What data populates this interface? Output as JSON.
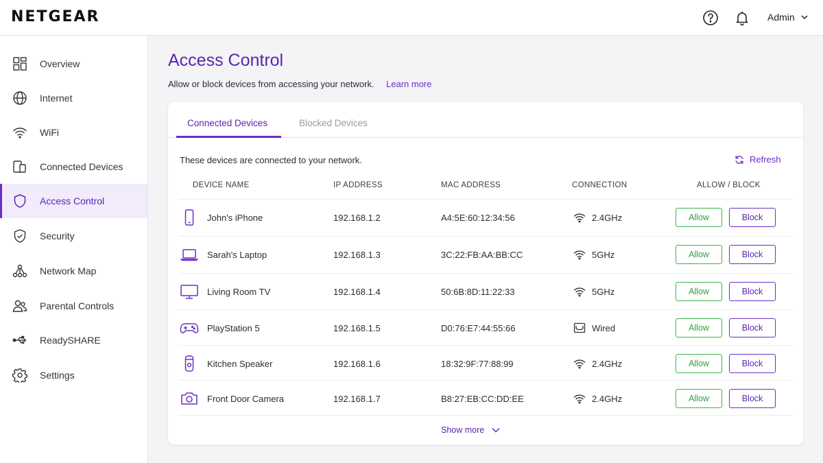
{
  "header": {
    "logo": "NETGEAR",
    "help_icon": "help-circle-icon",
    "notifications_icon": "bell-icon",
    "user_label": "Admin"
  },
  "colors": {
    "accent": "#6a2fc6",
    "allow": "#39b54a",
    "active_bg": "#f1ebfb"
  },
  "sidebar": {
    "items": [
      {
        "label": "Overview",
        "icon": "dashboard-icon",
        "active": false
      },
      {
        "label": "Internet",
        "icon": "globe-icon",
        "active": false
      },
      {
        "label": "WiFi",
        "icon": "wifi-icon",
        "active": false
      },
      {
        "label": "Connected Devices",
        "icon": "devices-icon",
        "active": false
      },
      {
        "label": "Access Control",
        "icon": "shield-icon",
        "active": true
      },
      {
        "label": "Security",
        "icon": "shield-check-icon",
        "active": false
      },
      {
        "label": "Network Map",
        "icon": "network-map-icon",
        "active": false
      },
      {
        "label": "Parental Controls",
        "icon": "users-icon",
        "active": false
      },
      {
        "label": "ReadySHARE",
        "icon": "usb-icon",
        "active": false
      },
      {
        "label": "Settings",
        "icon": "gear-icon",
        "active": false
      }
    ]
  },
  "main": {
    "title": "Access Control",
    "description": "Allow or block devices from accessing your network.",
    "learn_more": "Learn more",
    "tabs": [
      {
        "label": "Connected Devices",
        "active": true
      },
      {
        "label": "Blocked Devices",
        "active": false
      }
    ],
    "card_description": "These devices are connected to your network.",
    "refresh_label": "Refresh",
    "columns": [
      "DEVICE NAME",
      "IP ADDRESS",
      "MAC ADDRESS",
      "CONNECTION",
      "ALLOW / BLOCK"
    ],
    "devices": [
      {
        "name": "John's iPhone",
        "icon": "phone-icon",
        "ip": "192.168.1.2",
        "mac": "A4:5E:60:12:34:56",
        "connection": "2.4GHz",
        "conn_icon": "wifi-icon"
      },
      {
        "name": "Sarah's Laptop",
        "icon": "laptop-icon",
        "ip": "192.168.1.3",
        "mac": "3C:22:FB:AA:BB:CC",
        "connection": "5GHz",
        "conn_icon": "wifi-icon"
      },
      {
        "name": "Living Room TV",
        "icon": "tv-icon",
        "ip": "192.168.1.4",
        "mac": "50:6B:8D:11:22:33",
        "connection": "5GHz",
        "conn_icon": "wifi-icon"
      },
      {
        "name": "PlayStation 5",
        "icon": "gamepad-icon",
        "ip": "192.168.1.5",
        "mac": "D0:76:E7:44:55:66",
        "connection": "Wired",
        "conn_icon": "ethernet-icon"
      },
      {
        "name": "Kitchen Speaker",
        "icon": "speaker-icon",
        "ip": "192.168.1.6",
        "mac": "18:32:9F:77:88:99",
        "connection": "2.4GHz",
        "conn_icon": "wifi-icon"
      },
      {
        "name": "Front Door Camera",
        "icon": "camera-icon",
        "ip": "192.168.1.7",
        "mac": "B8:27:EB:CC:DD:EE",
        "connection": "2.4GHz",
        "conn_icon": "wifi-icon"
      }
    ],
    "allow_label": "Allow",
    "block_label": "Block",
    "show_more": "Show more"
  }
}
